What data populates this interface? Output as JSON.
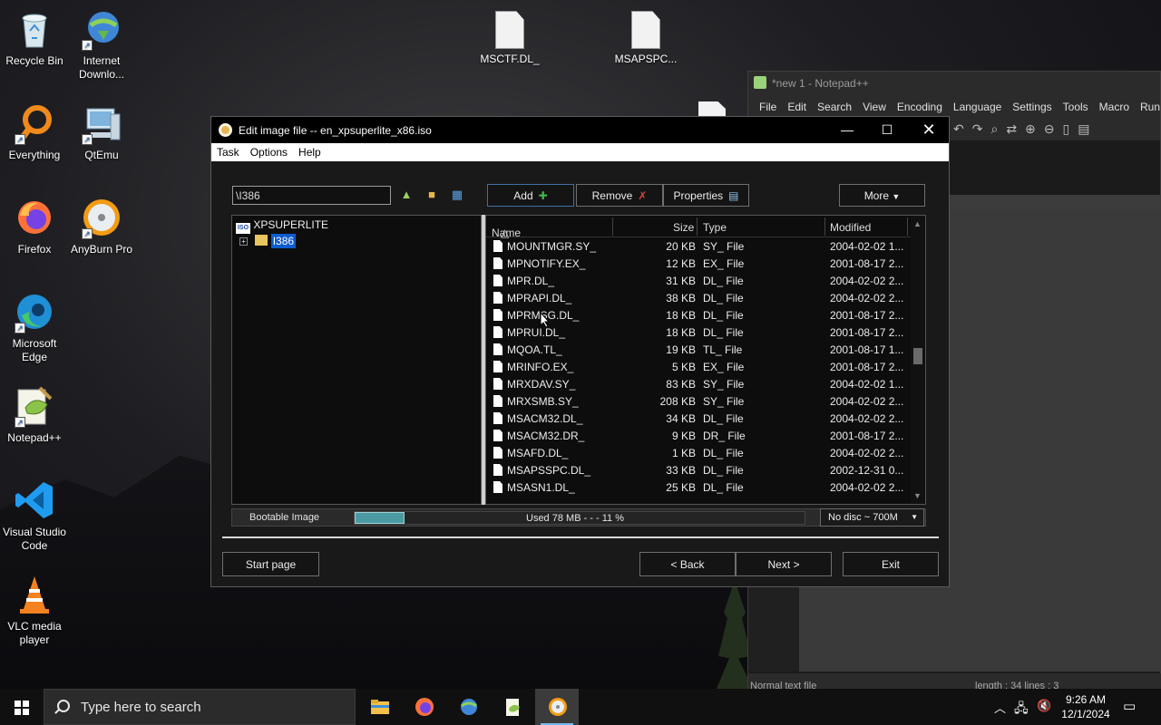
{
  "desktop": {
    "icons": [
      {
        "label": "Recycle Bin"
      },
      {
        "label": "Internet Downlo..."
      },
      {
        "label": "Everything"
      },
      {
        "label": "QtEmu"
      },
      {
        "label": "Firefox"
      },
      {
        "label": "AnyBurn Pro"
      },
      {
        "label": "Microsoft Edge"
      },
      {
        "label": "Notepad++"
      },
      {
        "label": "Visual Studio Code"
      },
      {
        "label": "VLC media player"
      }
    ],
    "files": [
      {
        "label": "MSCTF.DL_"
      },
      {
        "label": "MSAPSPC..."
      }
    ]
  },
  "notepad": {
    "title": "*new 1 - Notepad++",
    "menu": [
      "File",
      "Edit",
      "Search",
      "View",
      "Encoding",
      "Language",
      "Settings",
      "Tools",
      "Macro",
      "Run"
    ],
    "status_left": "Normal text file",
    "status_right": "length : 34    lines : 3"
  },
  "dialog": {
    "title": "Edit image file -- en_xpsuperlite_x86.iso",
    "menu": [
      "Task",
      "Options",
      "Help"
    ],
    "path_value": "\\I386",
    "buttons": {
      "add": "Add",
      "remove": "Remove",
      "properties": "Properties",
      "more": "More",
      "start_page": "Start page",
      "back": "< Back",
      "next": "Next >",
      "exit": "Exit"
    },
    "tree": {
      "root": "XPSUPERLITE",
      "child": "I386"
    },
    "columns": {
      "name": "Name",
      "size": "Size",
      "type": "Type",
      "modified": "Modified"
    },
    "files": [
      {
        "name": "MOUNTMGR.SY_",
        "size": "20 KB",
        "type": "SY_ File",
        "modified": "2004-02-02 1..."
      },
      {
        "name": "MPNOTIFY.EX_",
        "size": "12 KB",
        "type": "EX_ File",
        "modified": "2001-08-17 2..."
      },
      {
        "name": "MPR.DL_",
        "size": "31 KB",
        "type": "DL_ File",
        "modified": "2004-02-02 2..."
      },
      {
        "name": "MPRAPI.DL_",
        "size": "38 KB",
        "type": "DL_ File",
        "modified": "2004-02-02 2..."
      },
      {
        "name": "MPRMSG.DL_",
        "size": "18 KB",
        "type": "DL_ File",
        "modified": "2001-08-17 2..."
      },
      {
        "name": "MPRUI.DL_",
        "size": "18 KB",
        "type": "DL_ File",
        "modified": "2001-08-17 2..."
      },
      {
        "name": "MQOA.TL_",
        "size": "19 KB",
        "type": "TL_ File",
        "modified": "2001-08-17 1..."
      },
      {
        "name": "MRINFO.EX_",
        "size": "5 KB",
        "type": "EX_ File",
        "modified": "2001-08-17 2..."
      },
      {
        "name": "MRXDAV.SY_",
        "size": "83 KB",
        "type": "SY_ File",
        "modified": "2004-02-02 1..."
      },
      {
        "name": "MRXSMB.SY_",
        "size": "208 KB",
        "type": "SY_ File",
        "modified": "2004-02-02 2..."
      },
      {
        "name": "MSACM32.DL_",
        "size": "34 KB",
        "type": "DL_ File",
        "modified": "2004-02-02 2..."
      },
      {
        "name": "MSACM32.DR_",
        "size": "9 KB",
        "type": "DR_ File",
        "modified": "2001-08-17 2..."
      },
      {
        "name": "MSAFD.DL_",
        "size": "1 KB",
        "type": "DL_ File",
        "modified": "2004-02-02 2..."
      },
      {
        "name": "MSAPSSPC.DL_",
        "size": "33 KB",
        "type": "DL_ File",
        "modified": "2002-12-31 0..."
      },
      {
        "name": "MSASN1.DL_",
        "size": "25 KB",
        "type": "DL_ File",
        "modified": "2004-02-02 2..."
      }
    ],
    "status": {
      "bootable": "Bootable Image",
      "used": "Used  78 MB   - - -  11 %",
      "used_fraction": 0.11,
      "disc": "No disc ~ 700M"
    }
  },
  "taskbar": {
    "search_placeholder": "Type here to search",
    "time": "9:26 AM",
    "date": "12/1/2024"
  },
  "colors": {
    "progress_fill": "#4b9aa3",
    "selection": "#0f5bd0",
    "taskbar_accent": "#76b9ed"
  }
}
